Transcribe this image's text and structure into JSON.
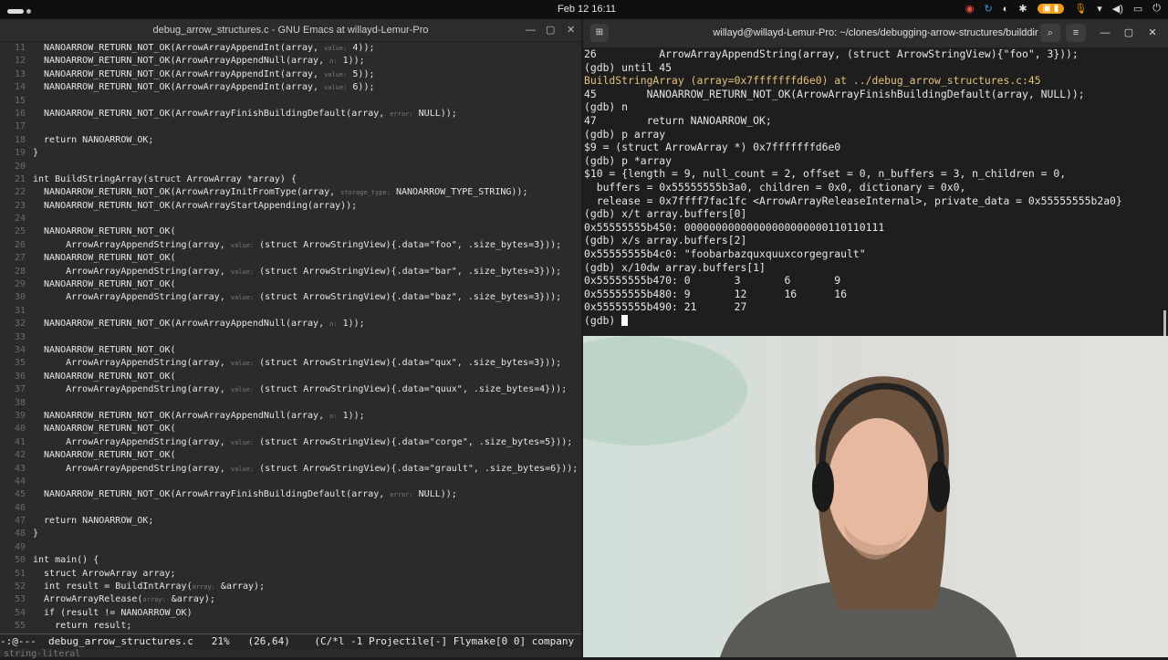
{
  "topbar": {
    "clock": "Feb 12  16:11"
  },
  "emacs": {
    "title": "debug_arrow_structures.c - GNU Emacs at willayd-Lemur-Pro",
    "lines": [
      {
        "n": "11",
        "t": "  NANOARROW_RETURN_NOT_OK(ArrowArrayAppendInt(array, ",
        "h": "value:",
        "r": " 4));"
      },
      {
        "n": "12",
        "t": "  NANOARROW_RETURN_NOT_OK(ArrowArrayAppendNull(array, ",
        "h": "n:",
        "r": " 1));"
      },
      {
        "n": "13",
        "t": "  NANOARROW_RETURN_NOT_OK(ArrowArrayAppendInt(array, ",
        "h": "value:",
        "r": " 5));"
      },
      {
        "n": "14",
        "t": "  NANOARROW_RETURN_NOT_OK(ArrowArrayAppendInt(array, ",
        "h": "value:",
        "r": " 6));"
      },
      {
        "n": "15",
        "t": "",
        "h": "",
        "r": ""
      },
      {
        "n": "16",
        "t": "  NANOARROW_RETURN_NOT_OK(ArrowArrayFinishBuildingDefault(array, ",
        "h": "error:",
        "r": " NULL));"
      },
      {
        "n": "17",
        "t": "",
        "h": "",
        "r": ""
      },
      {
        "n": "18",
        "t": "  return NANOARROW_OK;",
        "h": "",
        "r": ""
      },
      {
        "n": "19",
        "t": "}",
        "h": "",
        "r": ""
      },
      {
        "n": "20",
        "t": "",
        "h": "",
        "r": ""
      },
      {
        "n": "21",
        "t": "int BuildStringArray(struct ArrowArray *array) {",
        "h": "",
        "r": ""
      },
      {
        "n": "22",
        "t": "  NANOARROW_RETURN_NOT_OK(ArrowArrayInitFromType(array, ",
        "h": "storage_type:",
        "r": " NANOARROW_TYPE_STRING));"
      },
      {
        "n": "23",
        "t": "  NANOARROW_RETURN_NOT_OK(ArrowArrayStartAppending(array));",
        "h": "",
        "r": ""
      },
      {
        "n": "24",
        "t": "",
        "h": "",
        "r": ""
      },
      {
        "n": "25",
        "t": "  NANOARROW_RETURN_NOT_OK(",
        "h": "",
        "r": ""
      },
      {
        "n": "26",
        "t": "      ArrowArrayAppendString(array, ",
        "h": "value:",
        "r": " (struct ArrowStringView){.data=\"foo\", .size_bytes=3}));"
      },
      {
        "n": "27",
        "t": "  NANOARROW_RETURN_NOT_OK(",
        "h": "",
        "r": ""
      },
      {
        "n": "28",
        "t": "      ArrowArrayAppendString(array, ",
        "h": "value:",
        "r": " (struct ArrowStringView){.data=\"bar\", .size_bytes=3}));"
      },
      {
        "n": "29",
        "t": "  NANOARROW_RETURN_NOT_OK(",
        "h": "",
        "r": ""
      },
      {
        "n": "30",
        "t": "      ArrowArrayAppendString(array, ",
        "h": "value:",
        "r": " (struct ArrowStringView){.data=\"baz\", .size_bytes=3}));"
      },
      {
        "n": "31",
        "t": "",
        "h": "",
        "r": ""
      },
      {
        "n": "32",
        "t": "  NANOARROW_RETURN_NOT_OK(ArrowArrayAppendNull(array, ",
        "h": "n:",
        "r": " 1));"
      },
      {
        "n": "33",
        "t": "",
        "h": "",
        "r": ""
      },
      {
        "n": "34",
        "t": "  NANOARROW_RETURN_NOT_OK(",
        "h": "",
        "r": ""
      },
      {
        "n": "35",
        "t": "      ArrowArrayAppendString(array, ",
        "h": "value:",
        "r": " (struct ArrowStringView){.data=\"qux\", .size_bytes=3}));"
      },
      {
        "n": "36",
        "t": "  NANOARROW_RETURN_NOT_OK(",
        "h": "",
        "r": ""
      },
      {
        "n": "37",
        "t": "      ArrowArrayAppendString(array, ",
        "h": "value:",
        "r": " (struct ArrowStringView){.data=\"quux\", .size_bytes=4}));"
      },
      {
        "n": "38",
        "t": "",
        "h": "",
        "r": ""
      },
      {
        "n": "39",
        "t": "  NANOARROW_RETURN_NOT_OK(ArrowArrayAppendNull(array, ",
        "h": "n:",
        "r": " 1));"
      },
      {
        "n": "40",
        "t": "  NANOARROW_RETURN_NOT_OK(",
        "h": "",
        "r": ""
      },
      {
        "n": "41",
        "t": "      ArrowArrayAppendString(array, ",
        "h": "value:",
        "r": " (struct ArrowStringView){.data=\"corge\", .size_bytes=5}));"
      },
      {
        "n": "42",
        "t": "  NANOARROW_RETURN_NOT_OK(",
        "h": "",
        "r": ""
      },
      {
        "n": "43",
        "t": "      ArrowArrayAppendString(array, ",
        "h": "value:",
        "r": " (struct ArrowStringView){.data=\"grault\", .size_bytes=6}));"
      },
      {
        "n": "44",
        "t": "",
        "h": "",
        "r": ""
      },
      {
        "n": "45",
        "t": "  NANOARROW_RETURN_NOT_OK(ArrowArrayFinishBuildingDefault(array, ",
        "h": "error:",
        "r": " NULL));"
      },
      {
        "n": "46",
        "t": "",
        "h": "",
        "r": ""
      },
      {
        "n": "47",
        "t": "  return NANOARROW_OK;",
        "h": "",
        "r": ""
      },
      {
        "n": "48",
        "t": "}",
        "h": "",
        "r": ""
      },
      {
        "n": "49",
        "t": "",
        "h": "",
        "r": ""
      },
      {
        "n": "50",
        "t": "int main() {",
        "h": "",
        "r": ""
      },
      {
        "n": "51",
        "t": "  struct ArrowArray array;",
        "h": "",
        "r": ""
      },
      {
        "n": "52",
        "t": "  int result = BuildIntArray(",
        "h": "array:",
        "r": " &array);"
      },
      {
        "n": "53",
        "t": "  ArrowArrayRelease(",
        "h": "array:",
        "r": " &array);"
      },
      {
        "n": "54",
        "t": "  if (result != NANOARROW_OK)",
        "h": "",
        "r": ""
      },
      {
        "n": "55",
        "t": "    return result;",
        "h": "",
        "r": ""
      }
    ],
    "modeline": "-:@---  debug_arrow_structures.c   21%   (26,64)    (C/*l -1 Projectile[-] Flymake[0 0] company",
    "minibuffer": "string-literal"
  },
  "terminal": {
    "title": "willayd@willayd-Lemur-Pro: ~/clones/debugging-arrow-structures/builddir",
    "lines": [
      "26          ArrowArrayAppendString(array, (struct ArrowStringView){\"foo\", 3}));",
      "(gdb) until 45",
      "BuildStringArray (array=0x7fffffffd6e0) at ../debug_arrow_structures.c:45",
      "45        NANOARROW_RETURN_NOT_OK(ArrowArrayFinishBuildingDefault(array, NULL));",
      "(gdb) n",
      "47        return NANOARROW_OK;",
      "(gdb) p array",
      "$9 = (struct ArrowArray *) 0x7fffffffd6e0",
      "(gdb) p *array",
      "$10 = {length = 9, null_count = 2, offset = 0, n_buffers = 3, n_children = 0,",
      "  buffers = 0x55555555b3a0, children = 0x0, dictionary = 0x0,",
      "  release = 0x7ffff7fac1fc <ArrowArrayReleaseInternal>, private_data = 0x55555555b2a0}",
      "(gdb) x/t array.buffers[0]",
      "0x55555555b450: 00000000000000000000000110110111",
      "(gdb) x/s array.buffers[2]",
      "0x55555555b4c0: \"foobarbazquxquuxcorgegrault\"",
      "(gdb) x/10dw array.buffers[1]",
      "0x55555555b470: 0       3       6       9",
      "0x55555555b480: 9       12      16      16",
      "0x55555555b490: 21      27",
      "(gdb) "
    ]
  },
  "colors": {
    "accent": "#f39c12",
    "hex_addr": "#36a3d9",
    "func": "#e5c07b"
  },
  "icons": [
    "activities-dots",
    "notification-mute-icon",
    "network-icon",
    "volume-icon",
    "battery-icon",
    "power-icon",
    "terminal-tab-icon",
    "search-icon",
    "menu-icon",
    "minimize-icon",
    "maximize-icon",
    "close-icon"
  ]
}
